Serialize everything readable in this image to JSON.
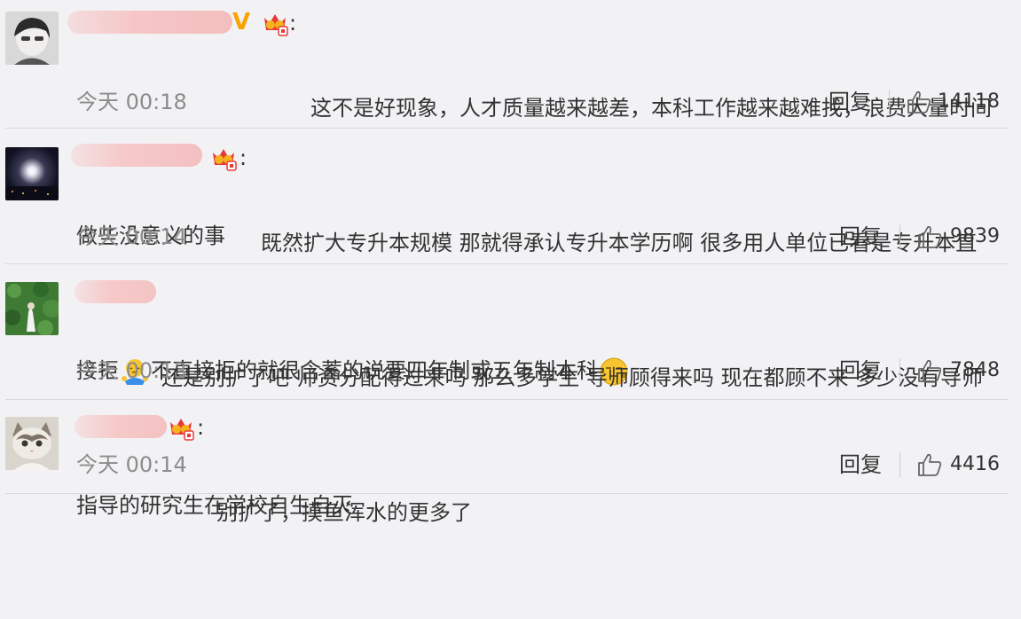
{
  "comments": [
    {
      "colon": ":",
      "lines": [
        "这不是好现象，人才质量越来越差，本科工作越来越难找，浪费大量时间",
        "做些没意义的事"
      ],
      "time": "今天 00:18",
      "reply": "回复",
      "likes": "14118"
    },
    {
      "colon": ":",
      "line1": "既然扩大专升本规模  那就得承认专升本学历啊  很多用人单位已看是专升本直",
      "line2_a": "接拒",
      "line2_b": "不直接拒的就很含蓄的说要四年制或五年制本科",
      "time": "今天 00:14",
      "reply": "回复",
      "likes": "9839"
    },
    {
      "lines": [
        "还是别扩了吧  师资分配得过来吗  那么多学生  导师顾得来吗  现在都顾不来  多少没有导师",
        "指导的研究生在学校自生自灭"
      ],
      "time": "今天 00:13",
      "reply": "回复",
      "likes": "7848"
    },
    {
      "colon": ":",
      "lines": [
        "别扩了，摸鱼浑水的更多了"
      ],
      "time": "今天 00:14",
      "reply": "回复",
      "likes": "4416"
    }
  ],
  "vip_mark": "V",
  "colors": {
    "background": "#f2f2f5",
    "text": "#333333",
    "time": "#8c8c8c",
    "vip": "#f7a400",
    "badge_red": "#e8393a",
    "badge_gold": "#f5b31b",
    "username_blur": "#f6c9c9"
  },
  "icons": [
    "crown-badge-icon",
    "thumbs-up-icon",
    "shrug-emoji-icon",
    "sleepy-emoji-icon"
  ]
}
